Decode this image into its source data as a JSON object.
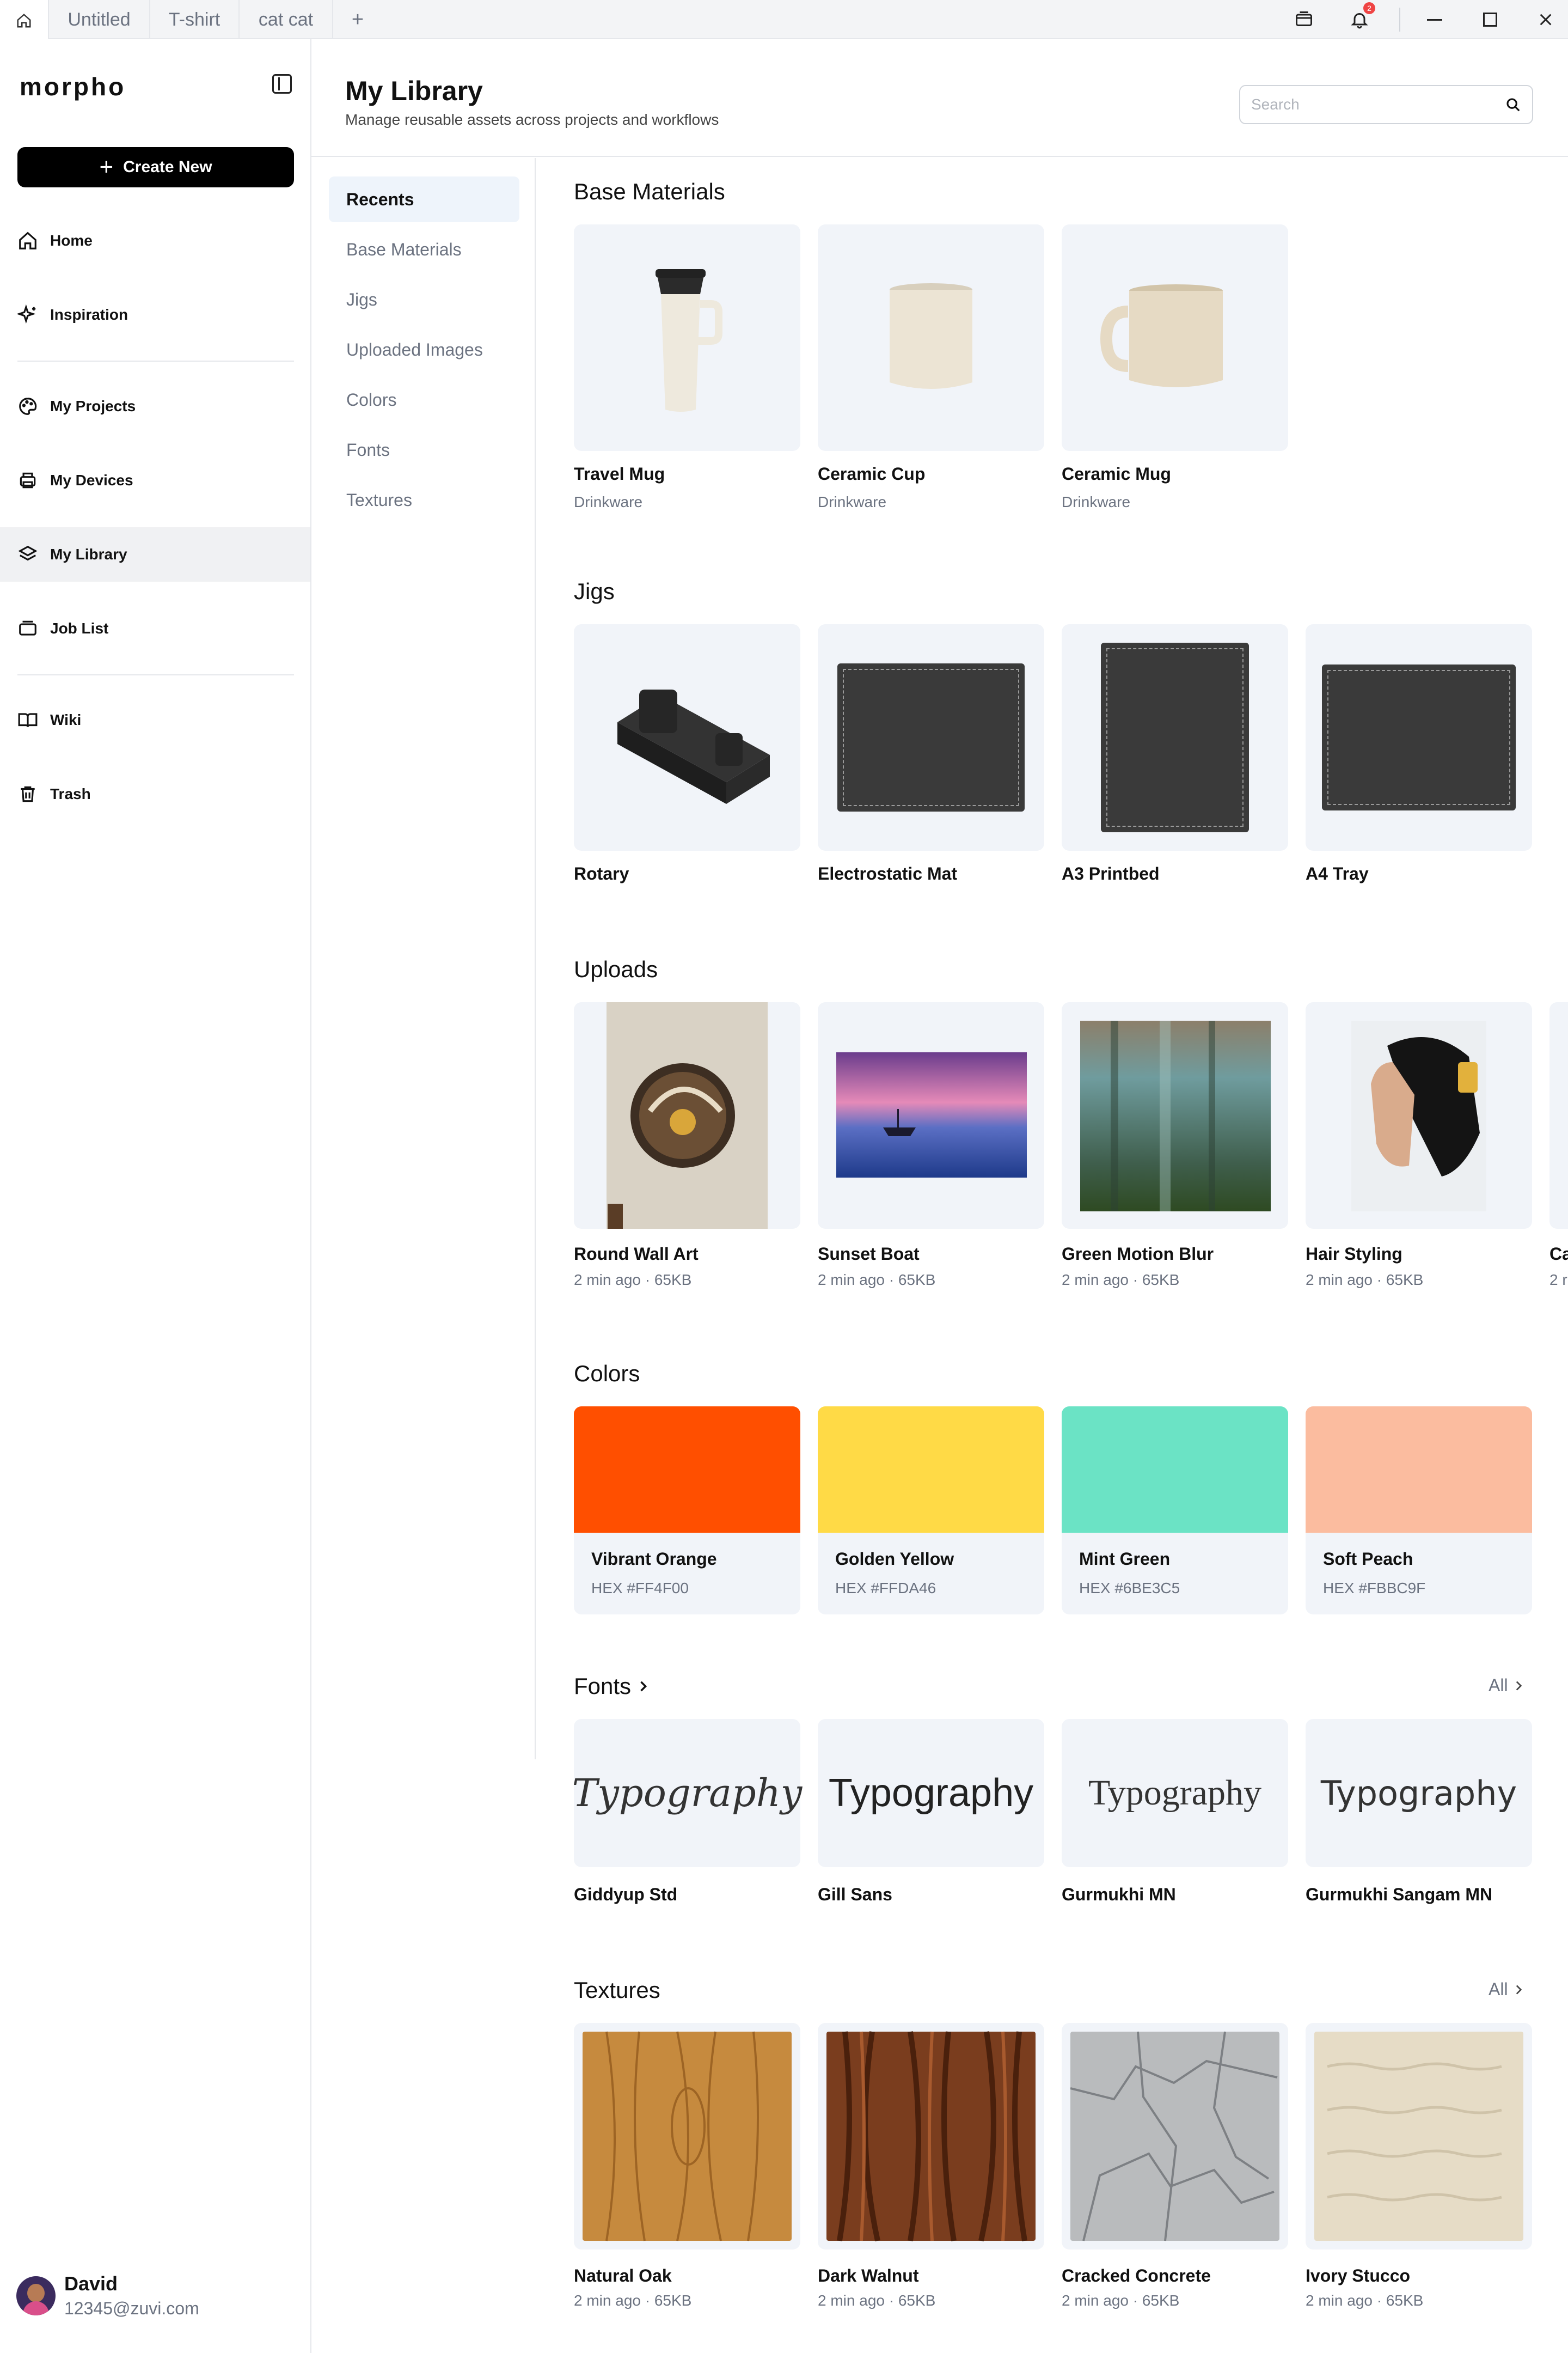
{
  "tabs": [
    "Untitled",
    "T-shirt",
    "cat cat",
    "+"
  ],
  "notif_count": "2",
  "logo": "morpho",
  "create_label": "Create New",
  "nav": [
    "Home",
    "Inspiration",
    "My Projects",
    "My Devices",
    "My Library",
    "Job List",
    "Wiki",
    "Trash"
  ],
  "user": {
    "name": "David",
    "email": "12345@zuvi.com"
  },
  "header": {
    "title": "My Library",
    "subtitle": "Manage reusable assets across projects and workflows",
    "search_placeholder": "Search"
  },
  "subnav": [
    "Recents",
    "Base Materials",
    "Jigs",
    "Uploaded Images",
    "Colors",
    "Fonts",
    "Textures"
  ],
  "sections": {
    "base": "Base Materials",
    "jigs": "Jigs",
    "uploads": "Uploads",
    "colors": "Colors",
    "fonts": "Fonts",
    "textures": "Textures",
    "all": "All"
  },
  "base_items": [
    {
      "name": "Travel Mug",
      "meta": "Drinkware"
    },
    {
      "name": "Ceramic Cup",
      "meta": "Drinkware"
    },
    {
      "name": "Ceramic Mug",
      "meta": "Drinkware"
    }
  ],
  "jig_items": [
    {
      "name": "Rotary"
    },
    {
      "name": "Electrostatic Mat"
    },
    {
      "name": "A3 Printbed"
    },
    {
      "name": "A4 Tray"
    }
  ],
  "upload_items": [
    {
      "name": "Round Wall Art",
      "meta": "2 min ago · 65KB"
    },
    {
      "name": "Sunset Boat",
      "meta": "2 min ago · 65KB"
    },
    {
      "name": "Green Motion Blur",
      "meta": "2 min ago · 65KB"
    },
    {
      "name": "Hair Styling",
      "meta": "2 min ago · 65KB"
    },
    {
      "name": "Ca",
      "meta": "2 r"
    }
  ],
  "color_items": [
    {
      "name": "Vibrant Orange",
      "hex": "HEX #FF4F00",
      "color": "#FF4F00"
    },
    {
      "name": "Golden Yellow",
      "hex": "HEX #FFDA46",
      "color": "#FFDA46"
    },
    {
      "name": "Mint Green",
      "hex": "HEX #6BE3C5",
      "color": "#6BE3C5"
    },
    {
      "name": "Soft Peach",
      "hex": "HEX #FBBC9F",
      "color": "#FBBC9F"
    }
  ],
  "font_items": [
    {
      "name": "Giddyup Std",
      "sample": "Typography"
    },
    {
      "name": "Gill Sans",
      "sample": "Typography"
    },
    {
      "name": "Gurmukhi MN",
      "sample": "Typography"
    },
    {
      "name": "Gurmukhi Sangam MN",
      "sample": "Typography"
    }
  ],
  "texture_items": [
    {
      "name": "Natural Oak",
      "meta": "2 min ago · 65KB"
    },
    {
      "name": "Dark Walnut",
      "meta": "2 min ago · 65KB"
    },
    {
      "name": "Cracked Concrete",
      "meta": "2 min ago · 65KB"
    },
    {
      "name": "Ivory Stucco",
      "meta": "2 min ago · 65KB"
    }
  ]
}
